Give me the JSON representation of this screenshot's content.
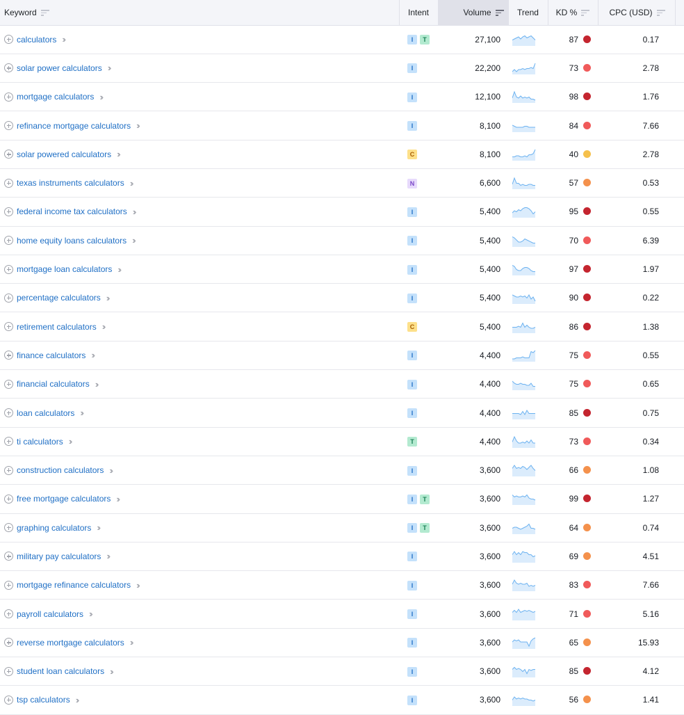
{
  "columns": {
    "keyword": "Keyword",
    "intent": "Intent",
    "volume": "Volume",
    "trend": "Trend",
    "kd": "KD %",
    "cpc": "CPC (USD)"
  },
  "sorted_column": "volume",
  "kd_colors": {
    "very_hard": "#c4252f",
    "hard": "#f05a5a",
    "difficult": "#f4914c",
    "possible": "#f5c04c"
  },
  "trend_color": "#6cb2f0",
  "trend_fill": "#dbecfc",
  "rows": [
    {
      "keyword": "calculators",
      "intent": [
        "I",
        "T"
      ],
      "volume": "27,100",
      "kd": "87",
      "kd_level": "very_hard",
      "cpc": "0.17",
      "trend": [
        5,
        6,
        7,
        8,
        6,
        8,
        9,
        7,
        8,
        9,
        7,
        5
      ]
    },
    {
      "keyword": "solar power calculators",
      "intent": [
        "I"
      ],
      "volume": "22,200",
      "kd": "73",
      "kd_level": "hard",
      "cpc": "2.78",
      "trend": [
        2,
        4,
        2,
        4,
        4,
        5,
        4,
        5,
        5,
        6,
        5,
        10
      ]
    },
    {
      "keyword": "mortgage calculators",
      "intent": [
        "I"
      ],
      "volume": "12,100",
      "kd": "98",
      "kd_level": "very_hard",
      "cpc": "1.76",
      "trend": [
        4,
        10,
        5,
        4,
        6,
        4,
        5,
        4,
        5,
        3,
        3,
        2
      ]
    },
    {
      "keyword": "refinance mortgage calculators",
      "intent": [
        "I"
      ],
      "volume": "8,100",
      "kd": "84",
      "kd_level": "hard",
      "cpc": "7.66",
      "trend": [
        6,
        5,
        4,
        4,
        4,
        4,
        5,
        5,
        4,
        4,
        4,
        4
      ]
    },
    {
      "keyword": "solar powered calculators",
      "intent": [
        "C"
      ],
      "volume": "8,100",
      "kd": "40",
      "kd_level": "possible",
      "cpc": "2.78",
      "trend": [
        3,
        3,
        4,
        4,
        3,
        3,
        4,
        3,
        5,
        5,
        6,
        10
      ]
    },
    {
      "keyword": "texas instruments calculators",
      "intent": [
        "N"
      ],
      "volume": "6,600",
      "kd": "57",
      "kd_level": "difficult",
      "cpc": "0.53",
      "trend": [
        4,
        10,
        5,
        5,
        3,
        4,
        3,
        3,
        4,
        4,
        3,
        3
      ]
    },
    {
      "keyword": "federal income tax calculators",
      "intent": [
        "I"
      ],
      "volume": "5,400",
      "kd": "95",
      "kd_level": "very_hard",
      "cpc": "0.55",
      "trend": [
        4,
        6,
        5,
        7,
        6,
        8,
        9,
        9,
        8,
        6,
        3,
        5
      ]
    },
    {
      "keyword": "home equity loans calculators",
      "intent": [
        "I"
      ],
      "volume": "5,400",
      "kd": "70",
      "kd_level": "hard",
      "cpc": "6.39",
      "trend": [
        9,
        8,
        6,
        4,
        4,
        5,
        7,
        6,
        5,
        4,
        3,
        3
      ]
    },
    {
      "keyword": "mortgage loan calculators",
      "intent": [
        "I"
      ],
      "volume": "5,400",
      "kd": "97",
      "kd_level": "very_hard",
      "cpc": "1.97",
      "trend": [
        9,
        8,
        5,
        4,
        4,
        6,
        7,
        7,
        6,
        4,
        3,
        3
      ]
    },
    {
      "keyword": "percentage calculators",
      "intent": [
        "I"
      ],
      "volume": "5,400",
      "kd": "90",
      "kd_level": "very_hard",
      "cpc": "0.22",
      "trend": [
        8,
        7,
        6,
        6,
        7,
        6,
        7,
        5,
        8,
        4,
        6,
        2
      ]
    },
    {
      "keyword": "retirement calculators",
      "intent": [
        "C"
      ],
      "volume": "5,400",
      "kd": "86",
      "kd_level": "very_hard",
      "cpc": "1.38",
      "trend": [
        5,
        5,
        5,
        6,
        5,
        9,
        5,
        7,
        5,
        4,
        4,
        5
      ]
    },
    {
      "keyword": "finance calculators",
      "intent": [
        "I"
      ],
      "volume": "4,400",
      "kd": "75",
      "kd_level": "hard",
      "cpc": "0.55",
      "trend": [
        2,
        2,
        3,
        3,
        3,
        4,
        3,
        3,
        3,
        9,
        8,
        10
      ]
    },
    {
      "keyword": "financial calculators",
      "intent": [
        "I"
      ],
      "volume": "4,400",
      "kd": "75",
      "kd_level": "hard",
      "cpc": "0.65",
      "trend": [
        8,
        6,
        5,
        5,
        6,
        5,
        5,
        4,
        4,
        6,
        3,
        3
      ]
    },
    {
      "keyword": "loan calculators",
      "intent": [
        "I"
      ],
      "volume": "4,400",
      "kd": "85",
      "kd_level": "very_hard",
      "cpc": "0.75",
      "trend": [
        5,
        5,
        5,
        5,
        4,
        7,
        4,
        8,
        5,
        5,
        5,
        5
      ]
    },
    {
      "keyword": "ti calculators",
      "intent": [
        "T"
      ],
      "volume": "4,400",
      "kd": "73",
      "kd_level": "hard",
      "cpc": "0.34",
      "trend": [
        5,
        10,
        6,
        4,
        4,
        5,
        4,
        6,
        4,
        7,
        4,
        4
      ]
    },
    {
      "keyword": "construction calculators",
      "intent": [
        "I"
      ],
      "volume": "3,600",
      "kd": "66",
      "kd_level": "difficult",
      "cpc": "1.08",
      "trend": [
        7,
        10,
        7,
        8,
        7,
        9,
        8,
        6,
        8,
        10,
        7,
        5
      ]
    },
    {
      "keyword": "free mortgage calculators",
      "intent": [
        "I",
        "T"
      ],
      "volume": "3,600",
      "kd": "99",
      "kd_level": "very_hard",
      "cpc": "1.27",
      "trend": [
        9,
        7,
        8,
        7,
        7,
        8,
        7,
        9,
        6,
        5,
        5,
        4
      ]
    },
    {
      "keyword": "graphing calculators",
      "intent": [
        "I",
        "T"
      ],
      "volume": "3,600",
      "kd": "64",
      "kd_level": "difficult",
      "cpc": "0.74",
      "trend": [
        5,
        6,
        6,
        5,
        4,
        5,
        6,
        7,
        9,
        5,
        5,
        4
      ]
    },
    {
      "keyword": "military pay calculators",
      "intent": [
        "I"
      ],
      "volume": "3,600",
      "kd": "69",
      "kd_level": "difficult",
      "cpc": "4.51",
      "trend": [
        7,
        10,
        7,
        9,
        7,
        10,
        9,
        9,
        7,
        7,
        5,
        6
      ]
    },
    {
      "keyword": "mortgage refinance calculators",
      "intent": [
        "I"
      ],
      "volume": "3,600",
      "kd": "83",
      "kd_level": "hard",
      "cpc": "7.66",
      "trend": [
        6,
        10,
        7,
        6,
        7,
        6,
        6,
        7,
        4,
        5,
        4,
        5
      ]
    },
    {
      "keyword": "payroll calculators",
      "intent": [
        "I"
      ],
      "volume": "3,600",
      "kd": "71",
      "kd_level": "hard",
      "cpc": "5.16",
      "trend": [
        7,
        9,
        7,
        10,
        7,
        8,
        9,
        8,
        9,
        8,
        7,
        8
      ]
    },
    {
      "keyword": "reverse mortgage calculators",
      "intent": [
        "I"
      ],
      "volume": "3,600",
      "kd": "65",
      "kd_level": "difficult",
      "cpc": "15.93",
      "trend": [
        6,
        8,
        7,
        8,
        6,
        6,
        6,
        6,
        2,
        7,
        9,
        10
      ]
    },
    {
      "keyword": "student loan calculators",
      "intent": [
        "I"
      ],
      "volume": "3,600",
      "kd": "85",
      "kd_level": "very_hard",
      "cpc": "4.12",
      "trend": [
        7,
        9,
        7,
        8,
        7,
        5,
        7,
        3,
        7,
        6,
        7,
        7
      ]
    },
    {
      "keyword": "tsp calculators",
      "intent": [
        "I"
      ],
      "volume": "3,600",
      "kd": "56",
      "kd_level": "difficult",
      "cpc": "1.41",
      "trend": [
        5,
        8,
        6,
        7,
        6,
        7,
        6,
        6,
        5,
        5,
        4,
        5
      ]
    }
  ]
}
